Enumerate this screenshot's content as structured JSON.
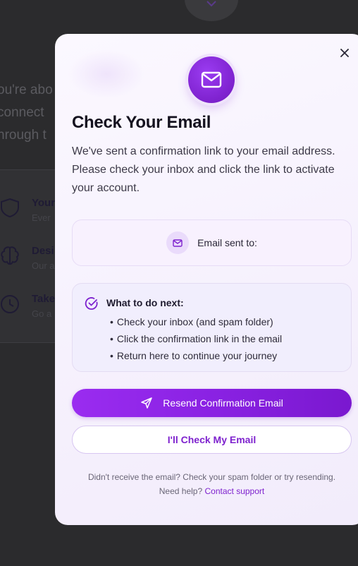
{
  "background": {
    "text_lines": [
      "ou're abo",
      "connect",
      "hrough t"
    ],
    "features": [
      {
        "title": "Your",
        "subtitle": "Ever",
        "icon": "shield-icon"
      },
      {
        "title": "Desi",
        "subtitle": "Our a",
        "icon": "brain-icon"
      },
      {
        "title": "Take",
        "subtitle": "Go a",
        "icon": "clock-icon"
      }
    ]
  },
  "modal": {
    "title": "Check Your Email",
    "description": "We've sent a confirmation link to your email address. Please check your inbox and click the link to activate your account.",
    "sent_label": "Email sent to:",
    "next_steps": {
      "title": "What to do next:",
      "items": [
        "Check your inbox (and spam folder)",
        "Click the confirmation link in the email",
        "Return here to continue your journey"
      ]
    },
    "resend_button": "Resend Confirmation Email",
    "check_button": "I'll Check My Email",
    "footnote_line1": "Didn't receive the email? Check your spam folder or try resending.",
    "footnote_help": "Need help?",
    "footnote_link": "Contact support"
  },
  "colors": {
    "accent": "#7e22ce",
    "accent_light": "#9a2cf0",
    "overlay": "#2b2b2d"
  },
  "icons": {
    "close": "close-icon",
    "mail": "mail-icon",
    "check": "check-circle-icon",
    "send": "send-icon"
  }
}
